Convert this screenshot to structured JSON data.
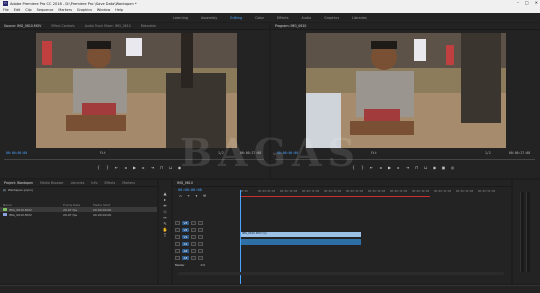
{
  "window": {
    "title": "Adobe Premiere Pro CC 2018 - D:\\Premiere Pro \\Save Data\\Wantapen *",
    "app_icon_text": "Pr",
    "controls": [
      "–",
      "□",
      "✕"
    ]
  },
  "menu": [
    "File",
    "Edit",
    "Clip",
    "Sequence",
    "Markers",
    "Graphics",
    "Window",
    "Help"
  ],
  "workspaces": {
    "tabs": [
      "Learning",
      "Assembly",
      "Editing",
      "Color",
      "Effects",
      "Audio",
      "Graphics",
      "Libraries"
    ],
    "active": "Editing"
  },
  "source_monitor": {
    "tabs": [
      "Source: IMG_0610.MOV",
      "Effect Controls",
      "Audio Track Mixer: IMG_0610",
      "Metadata"
    ],
    "timecode_in": "00:00:00:00",
    "fit": "Fit",
    "scale": "1/2",
    "timecode_out": "00:00:27:08"
  },
  "program_monitor": {
    "tabs": [
      "Program: IMG_0610"
    ],
    "timecode_in": "00:00:00:00",
    "fit": "Fit",
    "scale": "1/2",
    "timecode_out": "00:00:27:08"
  },
  "project_panel": {
    "tabs": [
      "Project: Wantapen",
      "Media Browser",
      "Libraries",
      "Info",
      "Effects",
      "Markers"
    ],
    "project_file": "Wantapen.prproj",
    "columns": [
      "Name",
      "Frame Rate",
      "Media Start"
    ],
    "items": [
      {
        "name": "IMG_0610.MOV",
        "rate": "29.97 fps",
        "start": "00:00:00:00",
        "color": "#7fbf5f"
      },
      {
        "name": "IMG_0610.MOV",
        "rate": "29.97 fps",
        "start": "00:00:00:00",
        "color": "#8fa0e0"
      }
    ]
  },
  "timeline": {
    "tab": "IMG_0610",
    "timecode": "00:00:00:00",
    "ruler": [
      "00:00",
      "00:00:05:00",
      "00:00:10:00",
      "00:00:15:00",
      "00:00:20:00",
      "00:00:25:00",
      "00:00:30:00",
      "00:00:35:00",
      "00:00:40:00",
      "00:00:45:00",
      "00:00:50:00",
      "00:00:55:00"
    ],
    "video_tracks": [
      "V3",
      "V2",
      "V1"
    ],
    "audio_tracks": [
      "A1",
      "A2",
      "A3"
    ],
    "master_label": "Master",
    "master_value": "0.0",
    "clip_name": "IMG_0610.MOV [V]"
  },
  "watermark": "BAGAS"
}
